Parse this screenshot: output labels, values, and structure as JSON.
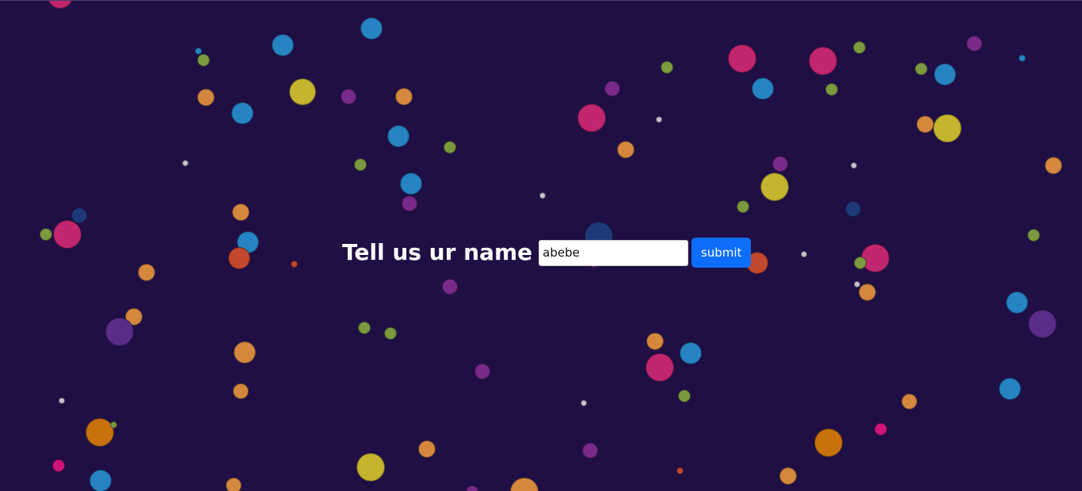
{
  "form": {
    "heading": "Tell us ur name",
    "input_value": "abebe",
    "submit_label": "submit"
  },
  "colors": {
    "background": "#200f45",
    "submit_button": "#0d6efd",
    "bubble_palette": [
      "#c2266f",
      "#2684c2",
      "#c4b42e",
      "#7b9a3e",
      "#d4883e",
      "#7a2a8a",
      "#c8c3cf",
      "#c2482e",
      "#1f3a7a",
      "#c8720e",
      "#d0157a",
      "#5a2d8a"
    ]
  }
}
